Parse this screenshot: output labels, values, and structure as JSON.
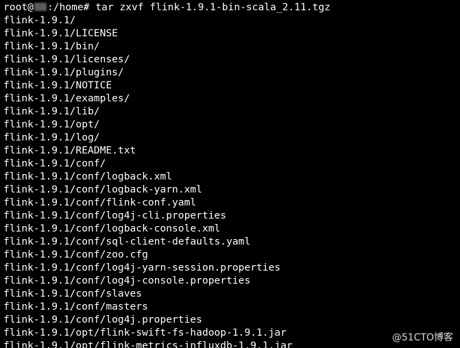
{
  "terminal": {
    "background": "#000000",
    "foreground": "#ffffff",
    "prompt": {
      "user": "root@",
      "path": ":/home#",
      "command": "tar zxvf flink-1.9.1-bin-scala_2.11.tgz"
    },
    "output_lines": [
      "flink-1.9.1/",
      "flink-1.9.1/LICENSE",
      "flink-1.9.1/bin/",
      "flink-1.9.1/licenses/",
      "flink-1.9.1/plugins/",
      "flink-1.9.1/NOTICE",
      "flink-1.9.1/examples/",
      "flink-1.9.1/lib/",
      "flink-1.9.1/opt/",
      "flink-1.9.1/log/",
      "flink-1.9.1/README.txt",
      "flink-1.9.1/conf/",
      "flink-1.9.1/conf/logback.xml",
      "flink-1.9.1/conf/logback-yarn.xml",
      "flink-1.9.1/conf/flink-conf.yaml",
      "flink-1.9.1/conf/log4j-cli.properties",
      "flink-1.9.1/conf/logback-console.xml",
      "flink-1.9.1/conf/sql-client-defaults.yaml",
      "flink-1.9.1/conf/zoo.cfg",
      "flink-1.9.1/conf/log4j-yarn-session.properties",
      "flink-1.9.1/conf/log4j-console.properties",
      "flink-1.9.1/conf/slaves",
      "flink-1.9.1/conf/masters",
      "flink-1.9.1/conf/log4j.properties",
      "flink-1.9.1/opt/flink-swift-fs-hadoop-1.9.1.jar",
      "flink-1.9.1/opt/flink-metrics-influxdb-1.9.1.jar"
    ]
  },
  "watermark": "@51CTO博客"
}
